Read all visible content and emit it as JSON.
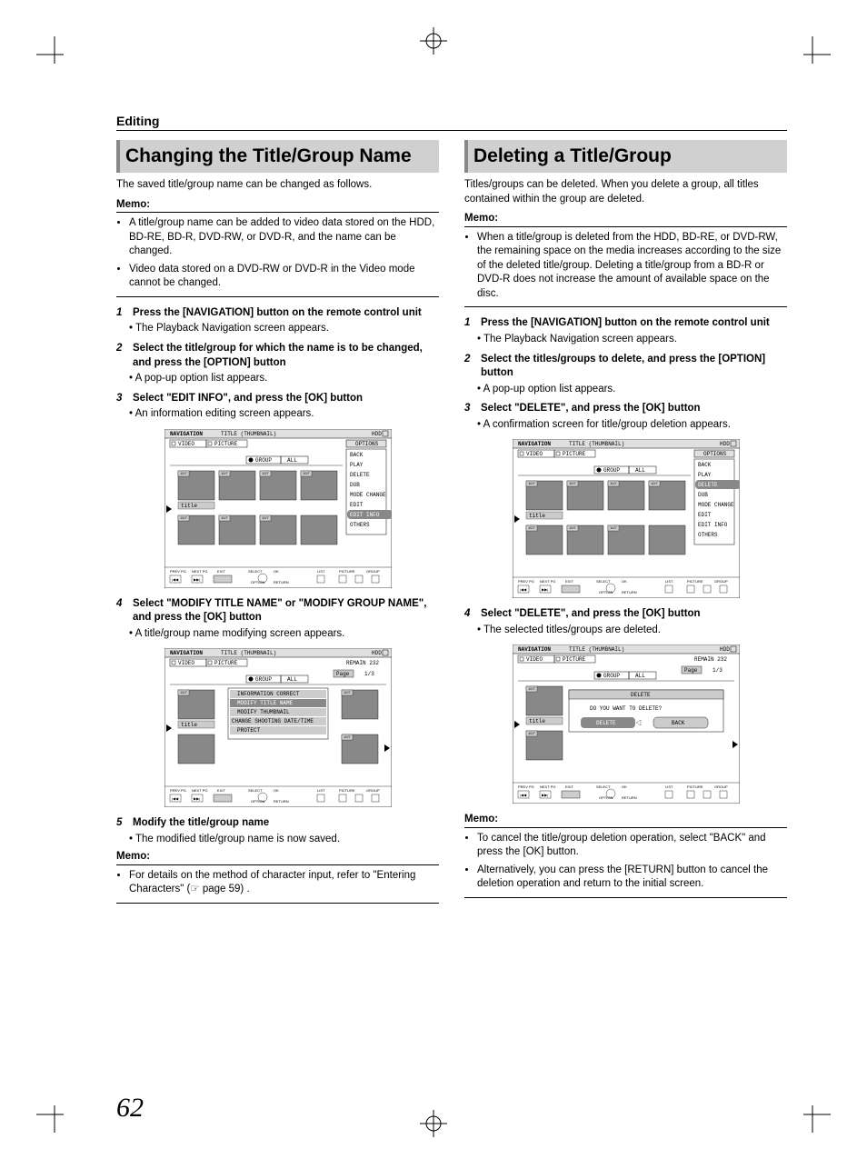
{
  "section_header": "Editing",
  "page_number": "62",
  "left": {
    "heading": "Changing the Title/Group Name",
    "intro": "The saved title/group name can be changed as follows.",
    "memo_label": "Memo:",
    "memo_items": [
      "A title/group name can be added to video data stored on the HDD, BD-RE, BD-R, DVD-RW, or DVD-R, and the name can be changed.",
      "Video data stored on a DVD-RW or DVD-R in the Video mode cannot be changed."
    ],
    "steps": [
      {
        "num": "1",
        "txt": "Press the [NAVIGATION] button on the remote control unit",
        "after": "The Playback Navigation screen appears."
      },
      {
        "num": "2",
        "txt": "Select the title/group for which the name is to be changed, and press the [OPTION] button",
        "after": "A pop-up option list appears."
      },
      {
        "num": "3",
        "txt": "Select \"EDIT INFO\", and press the [OK] button",
        "after": "An information editing screen appears."
      },
      {
        "num": "4",
        "txt": "Select \"MODIFY TITLE NAME\" or \"MODIFY GROUP NAME\", and press the [OK] button",
        "after": "A title/group name modifying screen appears."
      },
      {
        "num": "5",
        "txt": "Modify the title/group name",
        "after": "The modified title/group name is now saved."
      }
    ],
    "memo2_label": "Memo:",
    "memo2_items": [
      "For details on the method of character input, refer to \"Entering Characters\" (☞ page 59) ."
    ],
    "fig1": {
      "title": "NAVIGATION",
      "subtitle": "TITLE (THUMBNAIL)",
      "hdd": "HDD",
      "tab_video": "VIDEO",
      "tab_picture": "PICTURE",
      "options": "OPTIONS",
      "group": "GROUP",
      "all": "ALL",
      "menu": [
        "BACK",
        "PLAY",
        "DELETE",
        "DUB",
        "MODE CHANGE",
        "EDIT",
        "EDIT INFO",
        "OTHERS"
      ],
      "highlight_index": 6,
      "cell_labels": [
        "10/7",
        "10/7",
        "10/7",
        "10/7",
        "title",
        "10/7",
        "10/7",
        "10/7"
      ],
      "footer": [
        "PREV PG",
        "NEXT PG",
        "EXIT",
        "SELECT",
        "OK",
        "OPTION",
        "RETURN",
        "LIST",
        "PICTURE",
        "GROUP"
      ]
    },
    "fig2": {
      "title": "NAVIGATION",
      "subtitle": "TITLE (THUMBNAIL)",
      "hdd": "HDD",
      "tab_video": "VIDEO",
      "tab_picture": "PICTURE",
      "remain": "REMAIN 232",
      "page": "Page",
      "page_val": "1/3",
      "group": "GROUP",
      "all": "ALL",
      "menu": [
        "INFORMATION CORRECT",
        "MODIFY TITLE NAME",
        "MODIFY THUMBNAIL",
        "CHANGE SHOOTING DATE/TIME",
        "PROTECT"
      ],
      "highlight_index": 1,
      "cell_labels": [
        "10/7",
        "title",
        "10/7",
        "10/7"
      ],
      "footer": [
        "PREV PG",
        "NEXT PG",
        "EXIT",
        "SELECT",
        "OK",
        "OPTION",
        "RETURN",
        "LIST",
        "PICTURE",
        "GROUP"
      ]
    }
  },
  "right": {
    "heading": "Deleting a Title/Group",
    "intro": "Titles/groups can be deleted. When you delete a group, all titles contained within the group are deleted.",
    "memo_label": "Memo:",
    "memo_items": [
      "When a title/group is deleted from the HDD, BD-RE, or DVD-RW, the remaining space on the media increases according to the size of the deleted title/group. Deleting a title/group from a BD-R or DVD-R does not increase the amount of available space on the disc."
    ],
    "steps": [
      {
        "num": "1",
        "txt": "Press the [NAVIGATION] button on the remote control unit",
        "after": "The Playback Navigation screen appears."
      },
      {
        "num": "2",
        "txt": "Select the titles/groups to delete, and press the [OPTION] button",
        "after": "A pop-up option list appears."
      },
      {
        "num": "3",
        "txt": "Select \"DELETE\", and press the [OK] button",
        "after": "A confirmation screen for title/group deletion appears."
      },
      {
        "num": "4",
        "txt": "Select \"DELETE\", and press the [OK] button",
        "after": "The selected titles/groups are deleted."
      }
    ],
    "memo2_label": "Memo:",
    "memo2_items": [
      "To cancel the title/group deletion operation, select \"BACK\" and press the [OK] button.",
      "Alternatively, you can press the [RETURN] button to cancel the deletion operation and return to the initial screen."
    ],
    "fig1": {
      "title": "NAVIGATION",
      "subtitle": "TITLE (THUMBNAIL)",
      "hdd": "HDD",
      "tab_video": "VIDEO",
      "tab_picture": "PICTURE",
      "options": "OPTIONS",
      "group": "GROUP",
      "all": "ALL",
      "menu": [
        "BACK",
        "PLAY",
        "DELETE",
        "DUB",
        "MODE CHANGE",
        "EDIT",
        "EDIT INFO",
        "OTHERS"
      ],
      "highlight_index": 2,
      "cell_labels": [
        "10/7",
        "10/7",
        "10/7",
        "10/7",
        "title",
        "10/7",
        "10/7",
        "10/7"
      ],
      "footer": [
        "PREV PG",
        "NEXT PG",
        "EXIT",
        "SELECT",
        "OK",
        "OPTION",
        "RETURN",
        "LIST",
        "PICTURE",
        "GROUP"
      ]
    },
    "fig2": {
      "title": "NAVIGATION",
      "subtitle": "TITLE (THUMBNAIL)",
      "hdd": "HDD",
      "tab_video": "VIDEO",
      "tab_picture": "PICTURE",
      "remain": "REMAIN 232",
      "page": "Page",
      "page_val": "1/3",
      "group": "GROUP",
      "all": "ALL",
      "dialog_title": "DELETE",
      "dialog_msg": "DO YOU WANT TO DELETE?",
      "btn_delete": "DELETE",
      "btn_back": "BACK",
      "cell_labels": [
        "10/7",
        "title",
        "10/7"
      ],
      "footer": [
        "PREV PG",
        "NEXT PG",
        "EXIT",
        "SELECT",
        "OK",
        "OPTION",
        "RETURN",
        "LIST",
        "PICTURE",
        "GROUP"
      ]
    }
  }
}
